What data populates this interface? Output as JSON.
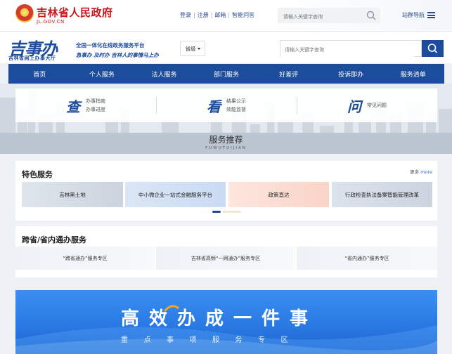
{
  "gov_header": {
    "name": "吉林省人民政府",
    "domain": "JL.GOV.CN",
    "links": [
      "登录",
      "注册",
      "邮箱",
      "智能问答"
    ],
    "search_placeholder": "请输入关键字查询",
    "site_nav": "站群导航"
  },
  "brand": {
    "logo": "吉事办",
    "logo_sub": "吉林省网上办事大厅",
    "slogan_line1": "全国一体化在线政务服务平台",
    "slogan_line2": "急事办 及时办 吉林人的事情马上办",
    "region_select": "省级",
    "search_placeholder": "请输入关键字查询"
  },
  "nav": [
    "首页",
    "个人服务",
    "法人服务",
    "部门服务",
    "好差评",
    "投诉即办",
    "服务清单"
  ],
  "quick": [
    {
      "glyph": "查",
      "links": [
        "办事指南",
        "办事进度"
      ]
    },
    {
      "glyph": "看",
      "links": [
        "结果公示",
        "效能监督"
      ]
    },
    {
      "glyph": "问",
      "links": [
        "常见问题"
      ]
    }
  ],
  "services": {
    "title": "服务推荐",
    "subtitle": "FUWUTUIJIAN"
  },
  "featured": {
    "title": "特色服务",
    "more_prefix": "更多",
    "more": "more",
    "items": [
      "吉林黑土地",
      "中小微企业一站式金融服务平台",
      "政策直达",
      "行政检查执法备案智能管理改革"
    ],
    "carousel_dots": 2
  },
  "cross_province": {
    "title": "跨省/省内通办服务",
    "items": [
      "“跨省通办”服务专区",
      "吉林省高频“一网通办”服务专区",
      "“省内通办”服务专区"
    ]
  },
  "banner": {
    "title": "高效办成一件事",
    "subtitle": "重点事项服务专区"
  },
  "colors": {
    "brand_blue": "#1c4c9c",
    "gov_red": "#c8161d",
    "banner_blue": "#2a79e4"
  }
}
